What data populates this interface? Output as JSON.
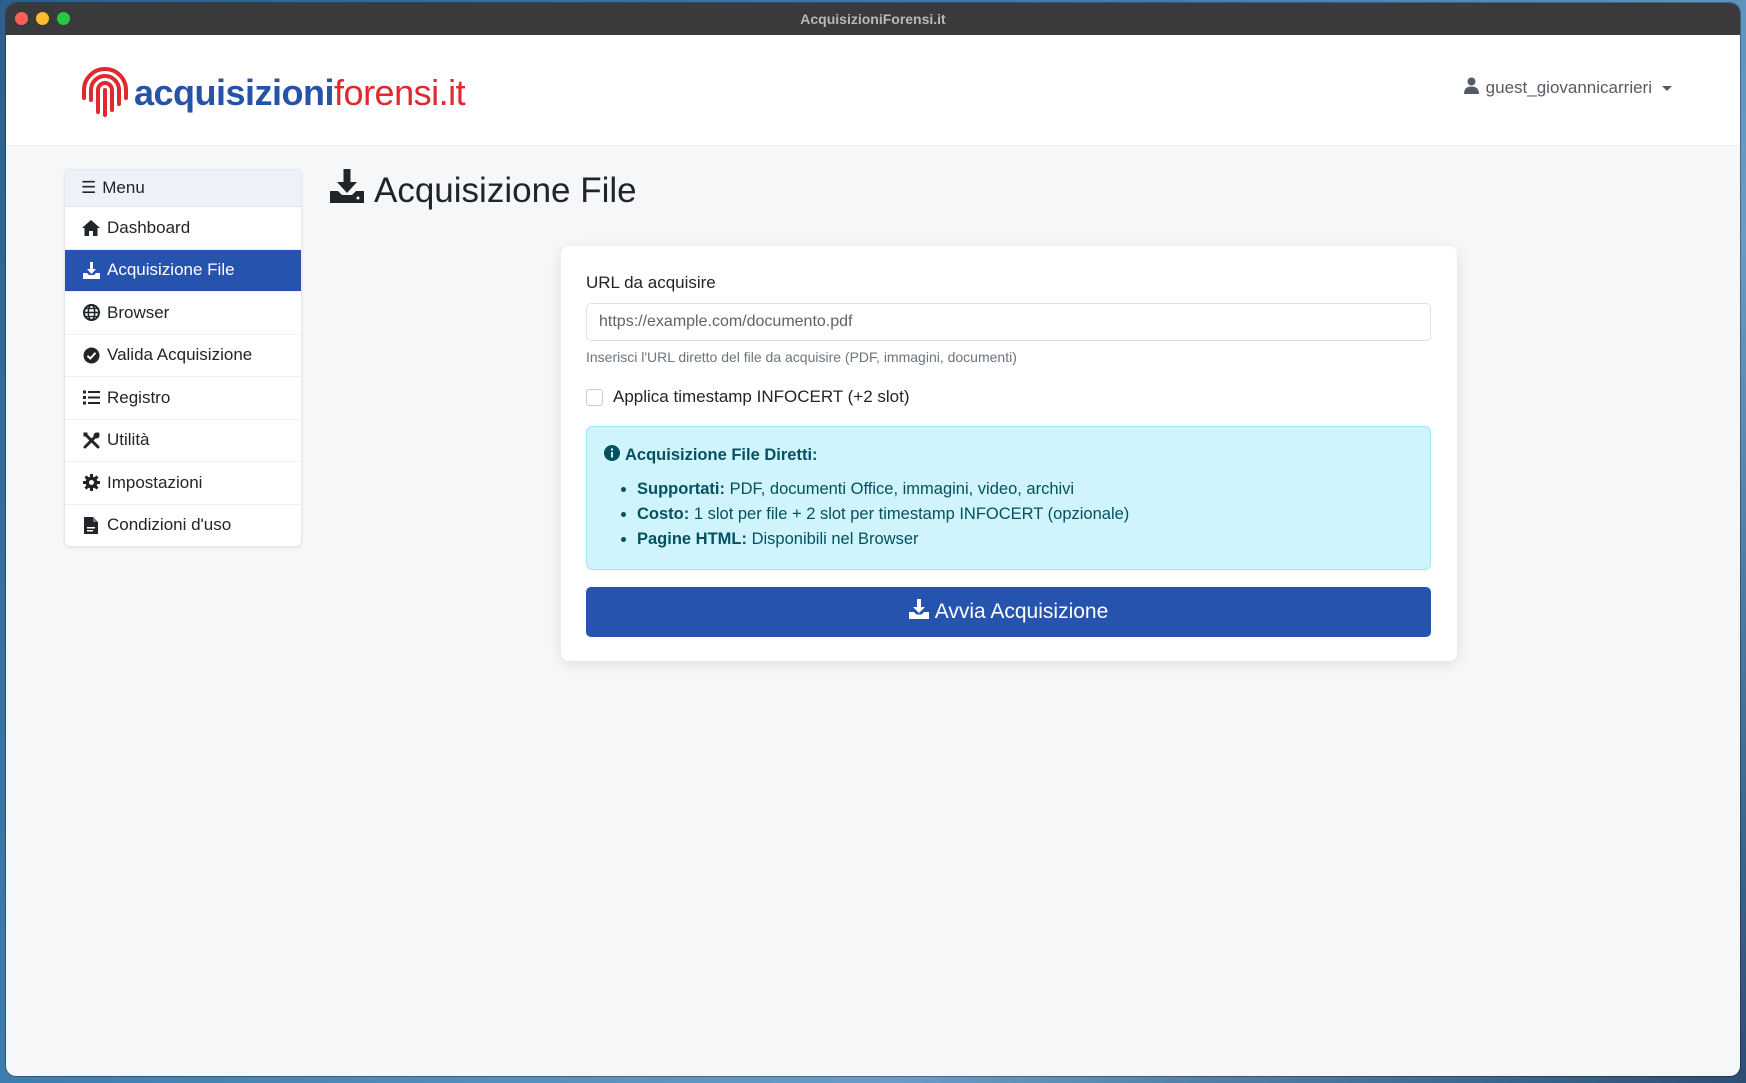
{
  "window": {
    "title": "AcquisizioniForensi.it"
  },
  "header": {
    "logo_part1": "acquisizioni",
    "logo_part2": "forensi.it",
    "logo_icon": "fingerprint-icon",
    "user_icon": "user-icon",
    "username": "guest_giovannicarrieri"
  },
  "sidebar": {
    "title": "Menu",
    "items": [
      {
        "label": "Dashboard",
        "icon": "home-icon"
      },
      {
        "label": "Acquisizione File",
        "icon": "download-icon",
        "active": true
      },
      {
        "label": "Browser",
        "icon": "globe-icon"
      },
      {
        "label": "Valida Acquisizione",
        "icon": "check-circle-icon"
      },
      {
        "label": "Registro",
        "icon": "list-icon"
      },
      {
        "label": "Utilità",
        "icon": "tools-icon"
      },
      {
        "label": "Impostazioni",
        "icon": "gear-icon"
      },
      {
        "label": "Condizioni d'uso",
        "icon": "document-icon"
      }
    ]
  },
  "main": {
    "page_title": "Acquisizione File",
    "form": {
      "url_label": "URL da acquisire",
      "url_placeholder": "https://example.com/documento.pdf",
      "url_value": "",
      "url_help": "Inserisci l'URL diretto del file da acquisire (PDF, immagini, documenti)",
      "timestamp_label": "Applica timestamp INFOCERT (+2 slot)",
      "timestamp_checked": false
    },
    "info": {
      "title": "Acquisizione File Diretti:",
      "items": [
        {
          "key": "Supportati:",
          "value": "PDF, documenti Office, immagini, video, archivi"
        },
        {
          "key": "Costo:",
          "value": "1 slot per file + 2 slot per timestamp INFOCERT (opzionale)"
        },
        {
          "key": "Pagine HTML:",
          "value": "Disponibili nel Browser"
        }
      ]
    },
    "submit_label": "Avvia Acquisizione"
  },
  "colors": {
    "primary": "#2553ad",
    "brand_blue": "#2553a6",
    "brand_red": "#e0282e",
    "info_bg": "#cff4fb",
    "info_text": "#055160"
  }
}
